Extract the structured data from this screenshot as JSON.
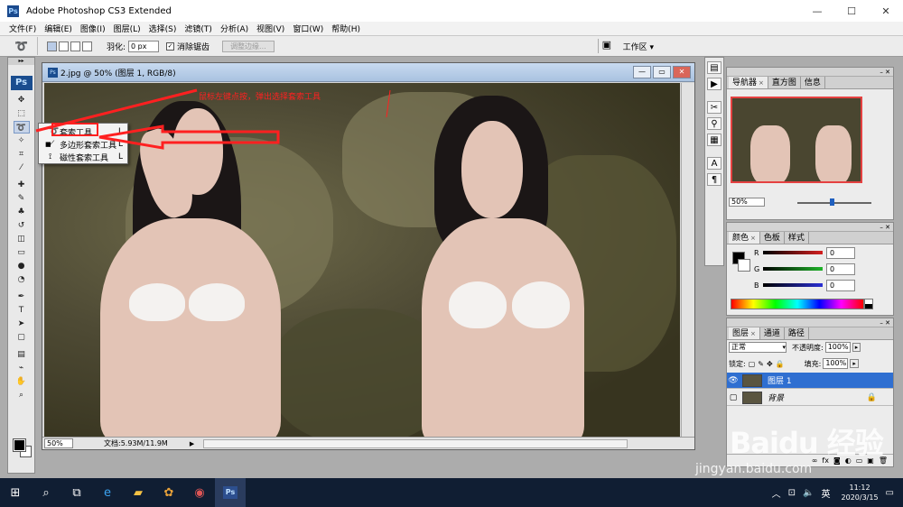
{
  "window": {
    "title": "Adobe Photoshop CS3 Extended",
    "ps_badge": "Ps",
    "minimize": "—",
    "maximize": "☐",
    "close": "✕"
  },
  "menu": [
    "文件(F)",
    "编辑(E)",
    "图像(I)",
    "图层(L)",
    "选择(S)",
    "滤镜(T)",
    "分析(A)",
    "视图(V)",
    "窗口(W)",
    "帮助(H)"
  ],
  "options": {
    "feather_label": "羽化:",
    "feather_value": "0 px",
    "antialias_label": "消除锯齿",
    "refine_edge": "调整边缘...",
    "workspace": "工作区 ▾"
  },
  "toolbox": {
    "logo": "Ps"
  },
  "flyout": {
    "items": [
      {
        "label": "套索工具",
        "shortcut": "L"
      },
      {
        "label": "多边形套索工具",
        "shortcut": "L"
      },
      {
        "label": "磁性套索工具",
        "shortcut": "L"
      }
    ]
  },
  "document": {
    "title": "2.jpg @ 50% (图层 1, RGB/8)",
    "zoom": "50%",
    "doc_info": "文档:5.93M/11.9M"
  },
  "annotation": {
    "text": "鼠标左键点按，弹出选择套索工具"
  },
  "panels": {
    "navigator_tabs": [
      "导航器",
      "直方图",
      "信息"
    ],
    "navigator_zoom": "50%",
    "color_tabs": [
      "颜色",
      "色板",
      "样式"
    ],
    "color_channels": [
      {
        "letter": "R",
        "value": "0",
        "color": "#d41f1f"
      },
      {
        "letter": "G",
        "value": "0",
        "color": "#1fb42a"
      },
      {
        "letter": "B",
        "value": "0",
        "color": "#2a2fd4"
      }
    ],
    "layers_tabs": [
      "图层",
      "通道",
      "路径"
    ],
    "blend_mode": "正常",
    "opacity_label": "不透明度:",
    "opacity_value": "100%",
    "lock_label": "锁定:",
    "fill_label": "填充:",
    "fill_value": "100%",
    "layers": [
      {
        "name": "图层 1",
        "selected": true
      },
      {
        "name": "背景",
        "selected": false
      }
    ]
  },
  "taskbar": {
    "time": "11:12",
    "date": "2020/3/15",
    "ime": "英",
    "ps": "Ps"
  },
  "watermark": {
    "brand": "Baidu 经验",
    "url": "jingyan.baidu.com"
  },
  "colors": {
    "selected_layer": "#2f6fd1",
    "annotation_red": "#ff2020"
  }
}
